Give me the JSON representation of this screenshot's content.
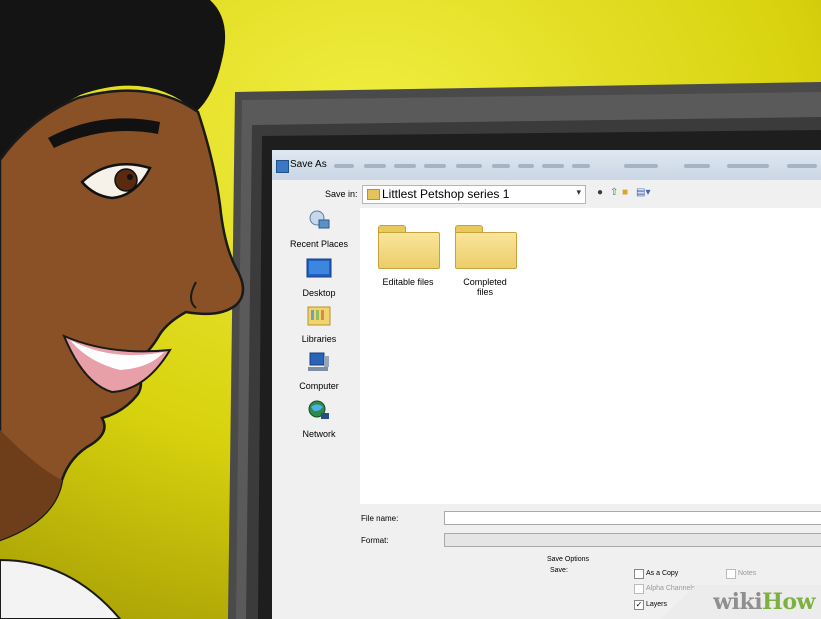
{
  "dialog": {
    "title": "Save As",
    "save_in_label": "Save in:",
    "save_in_value": "Littlest Petshop series 1"
  },
  "places": [
    {
      "label": "Recent Places",
      "icon": "recent-places-icon"
    },
    {
      "label": "Desktop",
      "icon": "desktop-icon"
    },
    {
      "label": "Libraries",
      "icon": "libraries-icon"
    },
    {
      "label": "Computer",
      "icon": "computer-icon"
    },
    {
      "label": "Network",
      "icon": "network-icon"
    }
  ],
  "folders": [
    {
      "label": "Editable files"
    },
    {
      "label": "Completed files"
    }
  ],
  "file_name_label": "File name:",
  "format_label": "Format:",
  "save_options": {
    "heading": "Save Options",
    "save_label": "Save:",
    "as_a_copy": "As a Copy",
    "notes": "Notes",
    "alpha_channels": "Alpha Channels",
    "layers": "Layers"
  },
  "watermark": "wikiHow",
  "colors": {
    "wall_yellow": "#d9d40e",
    "monitor_bezel": "#4a4a4a",
    "skin": "#8a5126",
    "watermark_wiki": "#8f8f8f",
    "watermark_how": "#7cb142"
  }
}
